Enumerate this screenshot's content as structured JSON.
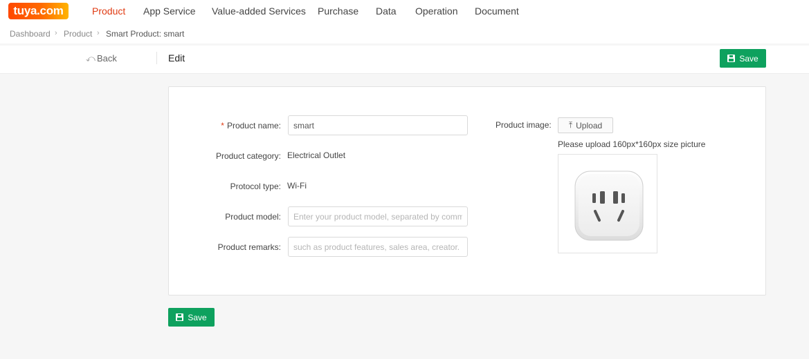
{
  "brand": {
    "logo_text": "tuya.com"
  },
  "nav": {
    "items": [
      {
        "label": "Product",
        "active": true
      },
      {
        "label": "App Service"
      },
      {
        "label": "Value-added Services"
      },
      {
        "label": "Purchase"
      },
      {
        "label": "Data"
      },
      {
        "label": "Operation"
      },
      {
        "label": "Document"
      }
    ]
  },
  "breadcrumb": [
    "Dashboard",
    "Product",
    "Smart Product: smart"
  ],
  "subheader": {
    "back_label": "Back",
    "title": "Edit",
    "save_label": "Save"
  },
  "form": {
    "product_name": {
      "label": "Product name",
      "value": "smart"
    },
    "product_category": {
      "label": "Product category",
      "value": "Electrical Outlet"
    },
    "protocol_type": {
      "label": "Protocol type",
      "value": "Wi-Fi"
    },
    "product_model": {
      "label": "Product model",
      "placeholder": "Enter your product model, separated by comma"
    },
    "product_remarks": {
      "label": "Product remarks",
      "placeholder": "such as product features, sales area, creator. Etc."
    },
    "product_image": {
      "label": "Product image",
      "upload_label": "Upload",
      "hint": "Please upload 160px*160px size picture",
      "icon": "smart-socket-image"
    }
  },
  "footer": {
    "save_label": "Save"
  },
  "colors": {
    "accent": "#0ea15e",
    "active_nav": "#e03b13",
    "required": "#e03b13"
  }
}
